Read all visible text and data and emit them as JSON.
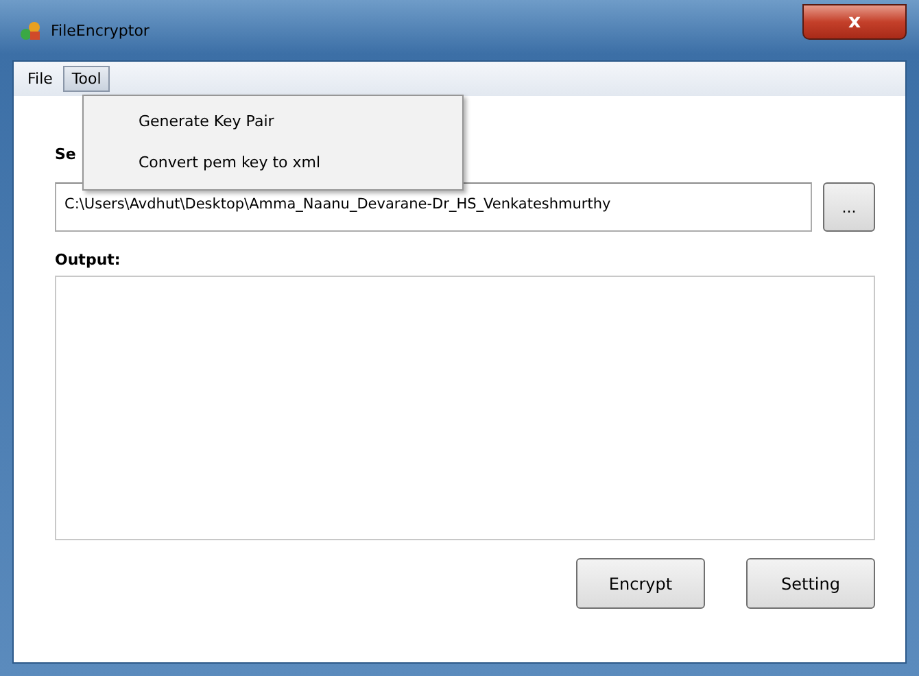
{
  "window": {
    "title": "FileEncryptor",
    "close": "x"
  },
  "menu": [
    {
      "label": "File",
      "selected": false
    },
    {
      "label": "Tool",
      "selected": true
    }
  ],
  "dropdown": {
    "items": [
      "Generate Key Pair",
      "Convert pem key to xml"
    ]
  },
  "source": {
    "label": "Se",
    "value": "C:\\Users\\Avdhut\\Desktop\\Amma_Naanu_Devarane-Dr_HS_Venkateshmurthy",
    "browse": "..."
  },
  "output": {
    "label": "Output:"
  },
  "buttons": [
    "Encrypt",
    "Setting"
  ]
}
